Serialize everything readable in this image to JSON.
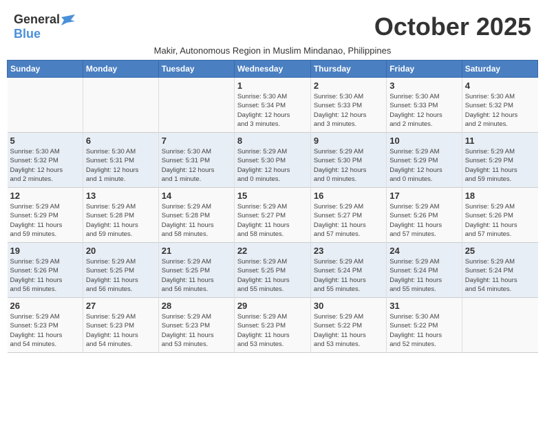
{
  "header": {
    "logo_general": "General",
    "logo_blue": "Blue",
    "month_title": "October 2025",
    "subtitle": "Makir, Autonomous Region in Muslim Mindanao, Philippines"
  },
  "days_of_week": [
    "Sunday",
    "Monday",
    "Tuesday",
    "Wednesday",
    "Thursday",
    "Friday",
    "Saturday"
  ],
  "weeks": [
    [
      {
        "num": "",
        "info": ""
      },
      {
        "num": "",
        "info": ""
      },
      {
        "num": "",
        "info": ""
      },
      {
        "num": "1",
        "info": "Sunrise: 5:30 AM\nSunset: 5:34 PM\nDaylight: 12 hours\nand 3 minutes."
      },
      {
        "num": "2",
        "info": "Sunrise: 5:30 AM\nSunset: 5:33 PM\nDaylight: 12 hours\nand 3 minutes."
      },
      {
        "num": "3",
        "info": "Sunrise: 5:30 AM\nSunset: 5:33 PM\nDaylight: 12 hours\nand 2 minutes."
      },
      {
        "num": "4",
        "info": "Sunrise: 5:30 AM\nSunset: 5:32 PM\nDaylight: 12 hours\nand 2 minutes."
      }
    ],
    [
      {
        "num": "5",
        "info": "Sunrise: 5:30 AM\nSunset: 5:32 PM\nDaylight: 12 hours\nand 2 minutes."
      },
      {
        "num": "6",
        "info": "Sunrise: 5:30 AM\nSunset: 5:31 PM\nDaylight: 12 hours\nand 1 minute."
      },
      {
        "num": "7",
        "info": "Sunrise: 5:30 AM\nSunset: 5:31 PM\nDaylight: 12 hours\nand 1 minute."
      },
      {
        "num": "8",
        "info": "Sunrise: 5:29 AM\nSunset: 5:30 PM\nDaylight: 12 hours\nand 0 minutes."
      },
      {
        "num": "9",
        "info": "Sunrise: 5:29 AM\nSunset: 5:30 PM\nDaylight: 12 hours\nand 0 minutes."
      },
      {
        "num": "10",
        "info": "Sunrise: 5:29 AM\nSunset: 5:29 PM\nDaylight: 12 hours\nand 0 minutes."
      },
      {
        "num": "11",
        "info": "Sunrise: 5:29 AM\nSunset: 5:29 PM\nDaylight: 11 hours\nand 59 minutes."
      }
    ],
    [
      {
        "num": "12",
        "info": "Sunrise: 5:29 AM\nSunset: 5:29 PM\nDaylight: 11 hours\nand 59 minutes."
      },
      {
        "num": "13",
        "info": "Sunrise: 5:29 AM\nSunset: 5:28 PM\nDaylight: 11 hours\nand 59 minutes."
      },
      {
        "num": "14",
        "info": "Sunrise: 5:29 AM\nSunset: 5:28 PM\nDaylight: 11 hours\nand 58 minutes."
      },
      {
        "num": "15",
        "info": "Sunrise: 5:29 AM\nSunset: 5:27 PM\nDaylight: 11 hours\nand 58 minutes."
      },
      {
        "num": "16",
        "info": "Sunrise: 5:29 AM\nSunset: 5:27 PM\nDaylight: 11 hours\nand 57 minutes."
      },
      {
        "num": "17",
        "info": "Sunrise: 5:29 AM\nSunset: 5:26 PM\nDaylight: 11 hours\nand 57 minutes."
      },
      {
        "num": "18",
        "info": "Sunrise: 5:29 AM\nSunset: 5:26 PM\nDaylight: 11 hours\nand 57 minutes."
      }
    ],
    [
      {
        "num": "19",
        "info": "Sunrise: 5:29 AM\nSunset: 5:26 PM\nDaylight: 11 hours\nand 56 minutes."
      },
      {
        "num": "20",
        "info": "Sunrise: 5:29 AM\nSunset: 5:25 PM\nDaylight: 11 hours\nand 56 minutes."
      },
      {
        "num": "21",
        "info": "Sunrise: 5:29 AM\nSunset: 5:25 PM\nDaylight: 11 hours\nand 56 minutes."
      },
      {
        "num": "22",
        "info": "Sunrise: 5:29 AM\nSunset: 5:25 PM\nDaylight: 11 hours\nand 55 minutes."
      },
      {
        "num": "23",
        "info": "Sunrise: 5:29 AM\nSunset: 5:24 PM\nDaylight: 11 hours\nand 55 minutes."
      },
      {
        "num": "24",
        "info": "Sunrise: 5:29 AM\nSunset: 5:24 PM\nDaylight: 11 hours\nand 55 minutes."
      },
      {
        "num": "25",
        "info": "Sunrise: 5:29 AM\nSunset: 5:24 PM\nDaylight: 11 hours\nand 54 minutes."
      }
    ],
    [
      {
        "num": "26",
        "info": "Sunrise: 5:29 AM\nSunset: 5:23 PM\nDaylight: 11 hours\nand 54 minutes."
      },
      {
        "num": "27",
        "info": "Sunrise: 5:29 AM\nSunset: 5:23 PM\nDaylight: 11 hours\nand 54 minutes."
      },
      {
        "num": "28",
        "info": "Sunrise: 5:29 AM\nSunset: 5:23 PM\nDaylight: 11 hours\nand 53 minutes."
      },
      {
        "num": "29",
        "info": "Sunrise: 5:29 AM\nSunset: 5:23 PM\nDaylight: 11 hours\nand 53 minutes."
      },
      {
        "num": "30",
        "info": "Sunrise: 5:29 AM\nSunset: 5:22 PM\nDaylight: 11 hours\nand 53 minutes."
      },
      {
        "num": "31",
        "info": "Sunrise: 5:30 AM\nSunset: 5:22 PM\nDaylight: 11 hours\nand 52 minutes."
      },
      {
        "num": "",
        "info": ""
      }
    ]
  ]
}
